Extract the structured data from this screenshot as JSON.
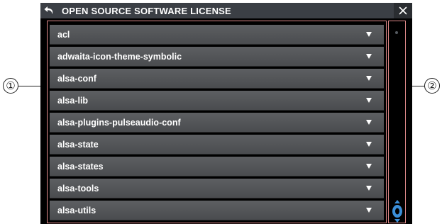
{
  "window": {
    "title": "OPEN SOURCE SOFTWARE LICENSE"
  },
  "icons": {
    "back": "back-arrow-icon",
    "close": "close-icon",
    "expand": "triangle-down-icon",
    "scroll": "scroll-thumb-icon"
  },
  "colors": {
    "titlebar": "#3b3f45",
    "row": "#545659",
    "highlight": "#e08a8a",
    "scroll_accent": "#3b8fd9"
  },
  "list": {
    "items": [
      {
        "label": "acl"
      },
      {
        "label": "adwaita-icon-theme-symbolic"
      },
      {
        "label": "alsa-conf"
      },
      {
        "label": "alsa-lib"
      },
      {
        "label": "alsa-plugins-pulseaudio-conf"
      },
      {
        "label": "alsa-state"
      },
      {
        "label": "alsa-states"
      },
      {
        "label": "alsa-tools"
      },
      {
        "label": "alsa-utils"
      }
    ]
  },
  "callouts": {
    "one": "①",
    "two": "②"
  }
}
